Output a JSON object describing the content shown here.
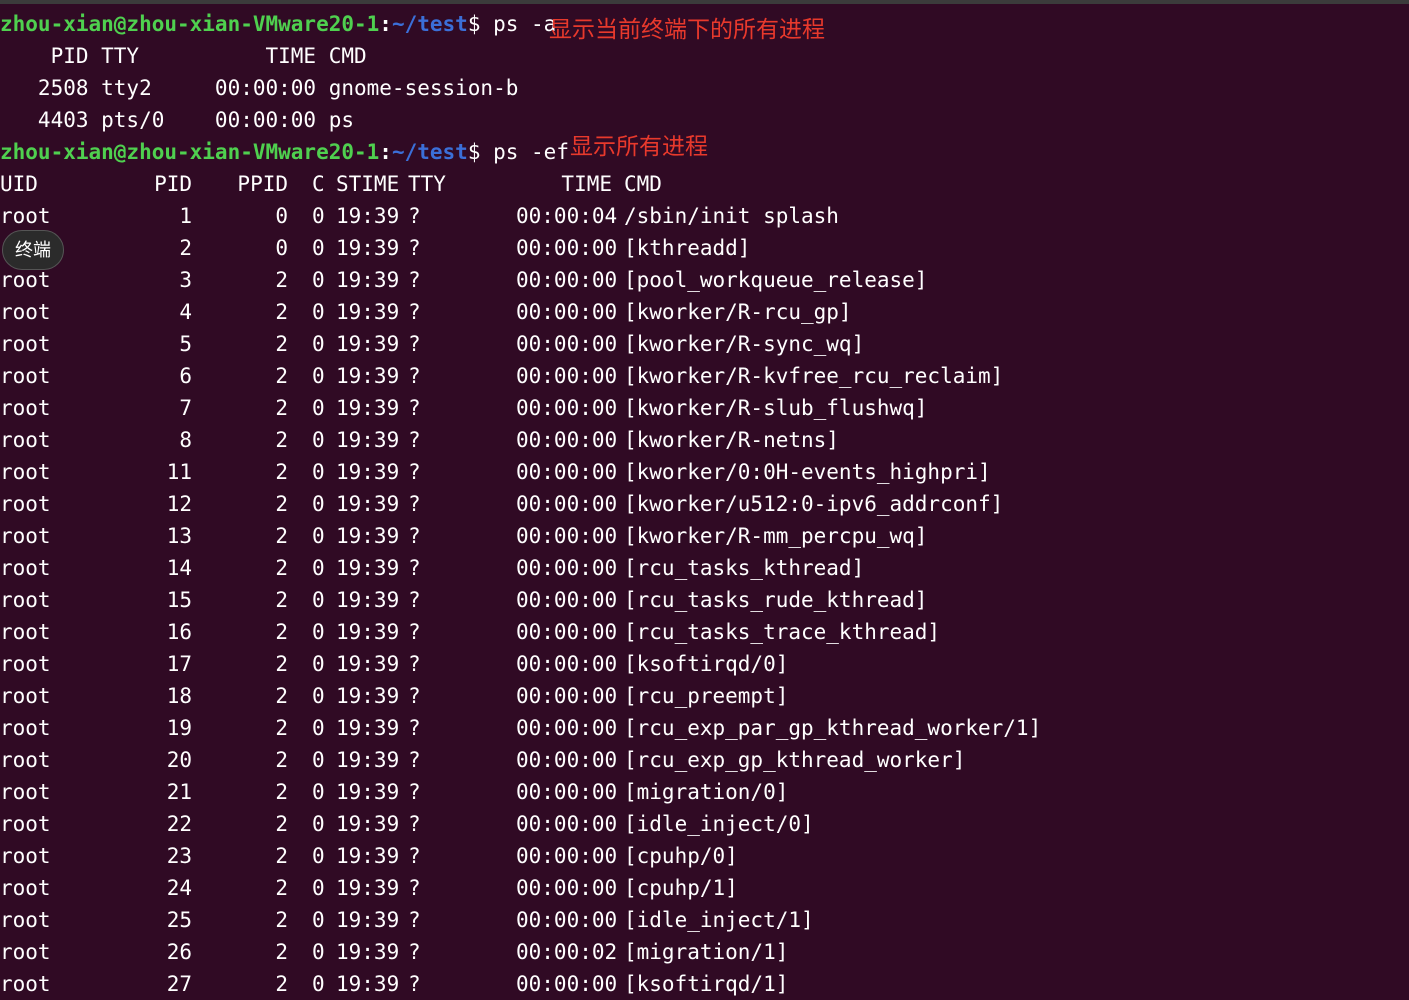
{
  "terminal": {
    "prompt_user_host": "zhou-xian@zhou-xian-VMware20-1",
    "prompt_path": "~/test",
    "prompt_dollar": "$ ",
    "cmd1": "ps -a",
    "annotation1": "显示当前终端下的所有进程",
    "ps_a_header": "    PID TTY          TIME CMD",
    "ps_a_rows": [
      "   2508 tty2     00:00:00 gnome-session-b",
      "   4403 pts/0    00:00:00 ps"
    ],
    "cmd2": "ps -ef",
    "annotation2": "显示所有进程",
    "ef_header": {
      "uid": "UID",
      "pid": "PID",
      "ppid": "PPID",
      "c": "C",
      "stime": "STIME",
      "tty": "TTY",
      "time": "TIME",
      "cmd": "CMD"
    },
    "ef_rows": [
      {
        "uid": "root",
        "pid": "1",
        "ppid": "0",
        "c": "0",
        "stime": "19:39",
        "tty": "?",
        "time": "00:00:04",
        "cmd": "/sbin/init splash"
      },
      {
        "uid": "",
        "pid": "2",
        "ppid": "0",
        "c": "0",
        "stime": "19:39",
        "tty": "?",
        "time": "00:00:00",
        "cmd": "[kthreadd]"
      },
      {
        "uid": "root",
        "pid": "3",
        "ppid": "2",
        "c": "0",
        "stime": "19:39",
        "tty": "?",
        "time": "00:00:00",
        "cmd": "[pool_workqueue_release]"
      },
      {
        "uid": "root",
        "pid": "4",
        "ppid": "2",
        "c": "0",
        "stime": "19:39",
        "tty": "?",
        "time": "00:00:00",
        "cmd": "[kworker/R-rcu_gp]"
      },
      {
        "uid": "root",
        "pid": "5",
        "ppid": "2",
        "c": "0",
        "stime": "19:39",
        "tty": "?",
        "time": "00:00:00",
        "cmd": "[kworker/R-sync_wq]"
      },
      {
        "uid": "root",
        "pid": "6",
        "ppid": "2",
        "c": "0",
        "stime": "19:39",
        "tty": "?",
        "time": "00:00:00",
        "cmd": "[kworker/R-kvfree_rcu_reclaim]"
      },
      {
        "uid": "root",
        "pid": "7",
        "ppid": "2",
        "c": "0",
        "stime": "19:39",
        "tty": "?",
        "time": "00:00:00",
        "cmd": "[kworker/R-slub_flushwq]"
      },
      {
        "uid": "root",
        "pid": "8",
        "ppid": "2",
        "c": "0",
        "stime": "19:39",
        "tty": "?",
        "time": "00:00:00",
        "cmd": "[kworker/R-netns]"
      },
      {
        "uid": "root",
        "pid": "11",
        "ppid": "2",
        "c": "0",
        "stime": "19:39",
        "tty": "?",
        "time": "00:00:00",
        "cmd": "[kworker/0:0H-events_highpri]"
      },
      {
        "uid": "root",
        "pid": "12",
        "ppid": "2",
        "c": "0",
        "stime": "19:39",
        "tty": "?",
        "time": "00:00:00",
        "cmd": "[kworker/u512:0-ipv6_addrconf]"
      },
      {
        "uid": "root",
        "pid": "13",
        "ppid": "2",
        "c": "0",
        "stime": "19:39",
        "tty": "?",
        "time": "00:00:00",
        "cmd": "[kworker/R-mm_percpu_wq]"
      },
      {
        "uid": "root",
        "pid": "14",
        "ppid": "2",
        "c": "0",
        "stime": "19:39",
        "tty": "?",
        "time": "00:00:00",
        "cmd": "[rcu_tasks_kthread]"
      },
      {
        "uid": "root",
        "pid": "15",
        "ppid": "2",
        "c": "0",
        "stime": "19:39",
        "tty": "?",
        "time": "00:00:00",
        "cmd": "[rcu_tasks_rude_kthread]"
      },
      {
        "uid": "root",
        "pid": "16",
        "ppid": "2",
        "c": "0",
        "stime": "19:39",
        "tty": "?",
        "time": "00:00:00",
        "cmd": "[rcu_tasks_trace_kthread]"
      },
      {
        "uid": "root",
        "pid": "17",
        "ppid": "2",
        "c": "0",
        "stime": "19:39",
        "tty": "?",
        "time": "00:00:00",
        "cmd": "[ksoftirqd/0]"
      },
      {
        "uid": "root",
        "pid": "18",
        "ppid": "2",
        "c": "0",
        "stime": "19:39",
        "tty": "?",
        "time": "00:00:00",
        "cmd": "[rcu_preempt]"
      },
      {
        "uid": "root",
        "pid": "19",
        "ppid": "2",
        "c": "0",
        "stime": "19:39",
        "tty": "?",
        "time": "00:00:00",
        "cmd": "[rcu_exp_par_gp_kthread_worker/1]"
      },
      {
        "uid": "root",
        "pid": "20",
        "ppid": "2",
        "c": "0",
        "stime": "19:39",
        "tty": "?",
        "time": "00:00:00",
        "cmd": "[rcu_exp_gp_kthread_worker]"
      },
      {
        "uid": "root",
        "pid": "21",
        "ppid": "2",
        "c": "0",
        "stime": "19:39",
        "tty": "?",
        "time": "00:00:00",
        "cmd": "[migration/0]"
      },
      {
        "uid": "root",
        "pid": "22",
        "ppid": "2",
        "c": "0",
        "stime": "19:39",
        "tty": "?",
        "time": "00:00:00",
        "cmd": "[idle_inject/0]"
      },
      {
        "uid": "root",
        "pid": "23",
        "ppid": "2",
        "c": "0",
        "stime": "19:39",
        "tty": "?",
        "time": "00:00:00",
        "cmd": "[cpuhp/0]"
      },
      {
        "uid": "root",
        "pid": "24",
        "ppid": "2",
        "c": "0",
        "stime": "19:39",
        "tty": "?",
        "time": "00:00:00",
        "cmd": "[cpuhp/1]"
      },
      {
        "uid": "root",
        "pid": "25",
        "ppid": "2",
        "c": "0",
        "stime": "19:39",
        "tty": "?",
        "time": "00:00:00",
        "cmd": "[idle_inject/1]"
      },
      {
        "uid": "root",
        "pid": "26",
        "ppid": "2",
        "c": "0",
        "stime": "19:39",
        "tty": "?",
        "time": "00:00:02",
        "cmd": "[migration/1]"
      },
      {
        "uid": "root",
        "pid": "27",
        "ppid": "2",
        "c": "0",
        "stime": "19:39",
        "tty": "?",
        "time": "00:00:00",
        "cmd": "[ksoftirqd/1]"
      }
    ],
    "tooltip": "终端"
  },
  "colors": {
    "background": "#300a24",
    "prompt_user": "#4fd04f",
    "prompt_path": "#3b6fd8",
    "annotation": "#e8392c"
  }
}
